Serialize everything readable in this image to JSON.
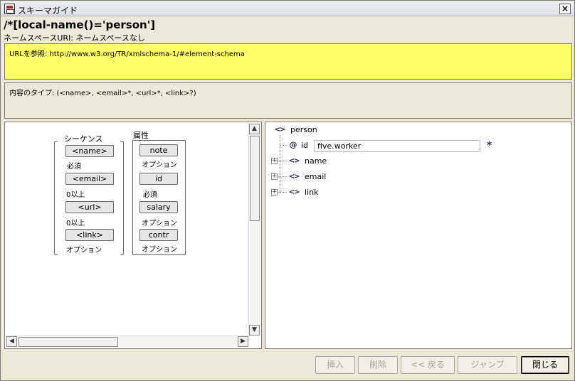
{
  "window": {
    "title": "スキーマガイド"
  },
  "header": {
    "xpath": "/*[local-name()='person']",
    "namespace": "ネームスペースURI: ネームスペースなし"
  },
  "reference": {
    "url_text": "URLを参照: http://www.w3.org/TR/xmlschema-1/#element-schema"
  },
  "content_type": {
    "text": "内容のタイプ: (<name>, <email>*, <url>*, <link>?)"
  },
  "schema": {
    "sequence_title": "シーケンス",
    "attributes_title": "属性",
    "sequence_items": [
      {
        "label": "<name>",
        "note": "必須"
      },
      {
        "label": "<email>",
        "note": "0以上"
      },
      {
        "label": "<url>",
        "note": "0以上"
      },
      {
        "label": "<link>",
        "note": "オプション"
      }
    ],
    "attribute_items": [
      {
        "label": "note",
        "note": "オプション"
      },
      {
        "label": "id",
        "note": "必須"
      },
      {
        "label": "salary",
        "note": "オプション"
      },
      {
        "label": "contr",
        "note": "オプション"
      }
    ]
  },
  "tree": {
    "root": "person",
    "attr_name": "id",
    "attr_value": "five.worker",
    "attr_marker": "*",
    "children": [
      "name",
      "email",
      "link"
    ],
    "elem_glyph": "<>",
    "attr_glyph": "@",
    "expand_glyph": "+"
  },
  "buttons": {
    "insert": "挿入",
    "delete": "削除",
    "back": "<< 戻る",
    "jump": "ジャンプ",
    "close": "閉じる"
  },
  "icons": {
    "close": "×",
    "scroll_up": "▲",
    "scroll_down": "▼",
    "scroll_left": "◀",
    "scroll_right": "▶"
  }
}
